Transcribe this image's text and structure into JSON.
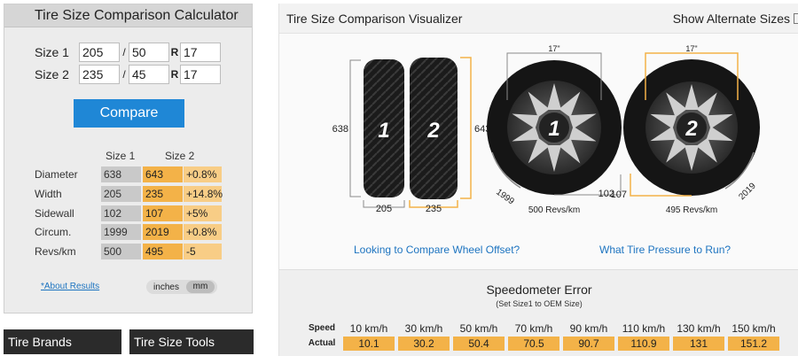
{
  "calculator": {
    "title": "Tire Size Comparison Calculator",
    "size1": {
      "label": "Size 1",
      "width": "205",
      "sep": "/",
      "aspect": "50",
      "r": "R",
      "rim": "17"
    },
    "size2": {
      "label": "Size 2",
      "width": "235",
      "sep": "/",
      "aspect": "45",
      "r": "R",
      "rim": "17"
    },
    "compare_label": "Compare",
    "results": {
      "col1": "Size 1",
      "col2": "Size 2",
      "rows": [
        {
          "label": "Diameter",
          "v1": "638",
          "v2": "643",
          "diff": "+0.8%"
        },
        {
          "label": "Width",
          "v1": "205",
          "v2": "235",
          "diff": "+14.8%"
        },
        {
          "label": "Sidewall",
          "v1": "102",
          "v2": "107",
          "diff": "+5%"
        },
        {
          "label": "Circum.",
          "v1": "1999",
          "v2": "2019",
          "diff": "+0.8%"
        },
        {
          "label": "Revs/km",
          "v1": "500",
          "v2": "495",
          "diff": "-5"
        }
      ]
    },
    "about_link": "*About Results",
    "units": {
      "inches": "inches",
      "mm": "mm",
      "selected": "mm"
    }
  },
  "bottom_nav": {
    "brands": "Tire Brands",
    "tools": "Tire Size Tools"
  },
  "visualizer": {
    "title": "Tire Size Comparison Visualizer",
    "show_alternate": "Show Alternate Sizes",
    "tire1_number": "1",
    "tire2_number": "2",
    "diameter1": "638",
    "diameter2": "643",
    "width1": "205",
    "width2": "235",
    "rim1": "17\"",
    "rim2": "17\"",
    "circ1": "1999",
    "circ2": "2019",
    "sidewall1": "102",
    "sidewall2": "107",
    "revs1": "500 Revs/km",
    "revs2": "495 Revs/km",
    "offset_link": "Looking to Compare Wheel Offset?",
    "pressure_link": "What Tire Pressure to Run?",
    "colors": {
      "dim1": "#8a8a8a",
      "dim2": "#f3b248",
      "link": "#1d74c0"
    }
  },
  "speedometer": {
    "title": "Speedometer Error",
    "subtitle": "(Set Size1 to OEM Size)",
    "speed_label": "Speed",
    "actual_label": "Actual",
    "speeds": [
      "10 km/h",
      "30 km/h",
      "50 km/h",
      "70 km/h",
      "90 km/h",
      "110 km/h",
      "130 km/h",
      "150 km/h"
    ],
    "actual": [
      "10.1",
      "30.2",
      "50.4",
      "70.5",
      "90.7",
      "110.9",
      "131",
      "151.2"
    ]
  }
}
